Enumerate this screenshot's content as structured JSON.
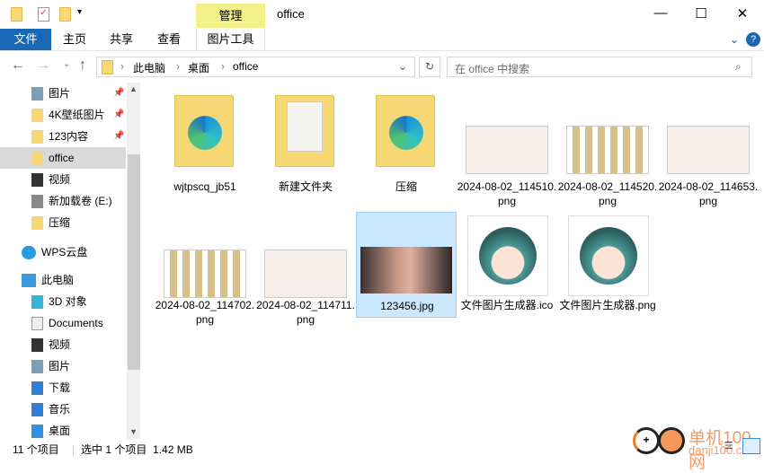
{
  "window": {
    "title": "office",
    "context_tab": "管理",
    "minimize": "—",
    "maximize": "☐",
    "close": "✕"
  },
  "quick_access_toolbar": {
    "dropdown": "▾"
  },
  "ribbon": {
    "tabs": [
      "文件",
      "主页",
      "共享",
      "查看",
      "图片工具"
    ],
    "help": "?",
    "collapse": "⌄"
  },
  "nav": {
    "back": "←",
    "forward": "→",
    "recent": "⌄",
    "up": "↑",
    "refresh": "↻",
    "dropdown": "⌄"
  },
  "breadcrumb": [
    "此电脑",
    "桌面",
    "office"
  ],
  "search": {
    "placeholder": "在 office 中搜索"
  },
  "sidebar": {
    "items": [
      {
        "label": "图片",
        "icon": "pictures-icon",
        "pinned": true
      },
      {
        "label": "4K壁纸图片",
        "icon": "folder-icon",
        "pinned": true
      },
      {
        "label": "123内容",
        "icon": "folder-icon",
        "pinned": true
      },
      {
        "label": "office",
        "icon": "folder-icon",
        "selected": true
      },
      {
        "label": "视频",
        "icon": "video-icon"
      },
      {
        "label": "新加载卷 (E:)",
        "icon": "drive-icon"
      },
      {
        "label": "压缩",
        "icon": "folder-icon"
      },
      {
        "label": "WPS云盘",
        "icon": "cloud-icon"
      },
      {
        "label": "此电脑",
        "icon": "computer-icon"
      },
      {
        "label": "3D 对象",
        "icon": "3d-objects-icon"
      },
      {
        "label": "Documents",
        "icon": "document-icon"
      },
      {
        "label": "视频",
        "icon": "video-icon"
      },
      {
        "label": "图片",
        "icon": "pictures-icon"
      },
      {
        "label": "下载",
        "icon": "download-icon"
      },
      {
        "label": "音乐",
        "icon": "music-icon"
      },
      {
        "label": "桌面",
        "icon": "desktop-icon"
      }
    ]
  },
  "files": [
    {
      "name": "wjtpscq_jb51",
      "type": "folder-edge"
    },
    {
      "name": "新建文件夹",
      "type": "folder-docs"
    },
    {
      "name": "压缩",
      "type": "folder-edge"
    },
    {
      "name": "2024-08-02_114510.png",
      "type": "screenshot"
    },
    {
      "name": "2024-08-02_114520.png",
      "type": "screenshot-grid"
    },
    {
      "name": "2024-08-02_114653.png",
      "type": "screenshot"
    },
    {
      "name": "2024-08-02_114702.png",
      "type": "screenshot-grid"
    },
    {
      "name": "2024-08-02_114711.png",
      "type": "screenshot"
    },
    {
      "name": "123456.jpg",
      "type": "photo",
      "selected": true
    },
    {
      "name": "文件图片生成器.ico",
      "type": "avatar"
    },
    {
      "name": "文件图片生成器.png",
      "type": "avatar"
    }
  ],
  "status": {
    "count": "11 个项目",
    "selection": "选中 1 个项目  1.42 MB"
  },
  "watermark": {
    "text": "单机100网",
    "url_text": "danji100.com"
  },
  "colors": {
    "accent": "#1a68b5",
    "selection": "#cce8ff",
    "context_tab": "#f3f08a"
  }
}
